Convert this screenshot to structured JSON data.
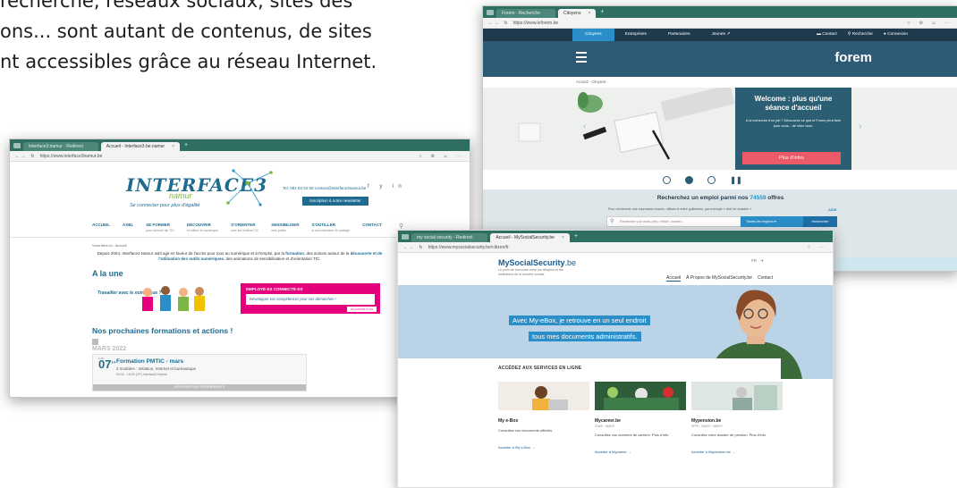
{
  "headline": {
    "lines": [
      "recherche, réseaux sociaux, sites des",
      "ons... sont autant de contenus, de sites",
      "nt accessibles grâce au réseau Internet."
    ]
  },
  "interface3": {
    "tabs": [
      "Interface3.namur - Redirect",
      "Accueil - Interface3.be.namur"
    ],
    "url": "https://www.interface3namur.be",
    "logo_main": "INTERFACE3",
    "logo_city": "namur",
    "tagline": "Se connecter pour plus d'égalité",
    "contact": "Tel: 081 83 54 50   contact@interface3namur.be",
    "social": "f y in",
    "cta": "Inscription à notre newsletter",
    "nav": [
      {
        "label": "ACCUEIL",
        "sub": ""
      },
      {
        "label": "ASBL",
        "sub": ""
      },
      {
        "label": "SE FORMER",
        "sub": "pour devenir lab TIC"
      },
      {
        "label": "DÉCOUVRIR",
        "sub": "et utiliser le numérique"
      },
      {
        "label": "S'ORIENTER",
        "sub": "vers les métiers TIC"
      },
      {
        "label": "SENSIBILISER",
        "sub": "vers public"
      },
      {
        "label": "S'OUTILLER",
        "sub": "le documentaire de partage"
      },
      {
        "label": "CONTACT",
        "sub": ""
      }
    ],
    "breadcrumb": "Vous êtes ici : Accueil",
    "intro_plain": "Depuis 2004, Interface3.Namur asbl agit en faveur de l'accès pour tous au numérique et à l'emploi, par la ",
    "intro_bold1": "formation",
    "intro_mid": ", des actions autour de la ",
    "intro_bold2": "découverte et de l'utilisation des outils numériques",
    "intro_end": ", des animations de sensibilisation et d'orientation TIC.",
    "section1": "A la une",
    "banner_left": "Travailler avec le numérique ?",
    "banner_pink_title": "EMPLOYÉ·ES CONNECTÉ·ES",
    "banner_pink_text": "Développer vos compétences pour vos démarches !",
    "banner_cta": "EN SAVOIR PLUS",
    "section2": "Nos prochaines formations et actions !",
    "month": "MARS 2022",
    "event_day": "LUN",
    "event_date": "07",
    "event_date_sup": "14",
    "event_title": "Formation PMTIC - mars",
    "event_sub": "2 modules : Initiation, Internet et bureautique",
    "event_meta": "09:00 - 16:00 (CP)  Interface3.Namur",
    "event_more": "AFFICHER PLUS D'ÉVÈNEMENTS"
  },
  "forem": {
    "tabs": [
      "Forem - Recherche",
      "Citoyens"
    ],
    "url": "https://www.leforem.be",
    "top": [
      "Citoyens",
      "Entreprises",
      "Partenaires",
      "Jeunes ↗"
    ],
    "top_right": [
      "Contact",
      "Recherche",
      "Connexion"
    ],
    "logo": "forem",
    "breadcrumb": "Accueil · Citoyens",
    "hero_title": "Welcome : plus qu'une séance d'accueil",
    "hero_text": "A la recherche d'un job ? Découvrez ce que le Forem peut faire pour vous... de chez vous.",
    "hero_cta": "Plus d'infos",
    "search_title_pre": "Recherchez un emploi parmi nos ",
    "search_count": "74559",
    "search_title_post": " offres",
    "search_hint": "Pour rechercher une expression exacte, utilisez le entre guillemets, par exemple « chef de chantier »",
    "aide": "AIDE",
    "search_placeholder": "Recherche par mots-clés, métier, numéro",
    "select": "Toutes les régions",
    "go": "rechercher"
  },
  "mysocial": {
    "tabs": [
      "my social security - Redirect",
      "Accueil - MySocialSecurity.be"
    ],
    "url": "https://www.mysocialsecurity.be/citizen/fr",
    "logo": "MySocialSecurity",
    "logo_tld": ".be",
    "sub": "Le point de rencontre entre les citoyens et les institutions de la sécurité sociale",
    "lang": "FR  ·  ➜",
    "nav": [
      "Accueil",
      "À Propos de MySocialSecurity.be",
      "Contact"
    ],
    "hero_line1": "Avec My-eBox, je retrouve en un seul endroit",
    "hero_line2": "tous mes documents administratifs.",
    "services_title": "ACCÉDEZ AUX SERVICES EN LIGNE",
    "cards": [
      {
        "title": "My e-Box",
        "meta": "",
        "desc": "Consultez vos documents officiels.",
        "link": "Accéder à My e-Box →"
      },
      {
        "title": "Mycareer.be",
        "meta": "ONSS · INASTI",
        "desc": "Consultez vos données de carrière. Plus d'info",
        "link": "Accéder à Mycareer →"
      },
      {
        "title": "Mypension.be",
        "meta": "SFPD · INASTI · AWIPH",
        "desc": "Consultez votre dossier de pension. Plus d'info",
        "link": "Accéder à Mypension.be →"
      }
    ]
  }
}
